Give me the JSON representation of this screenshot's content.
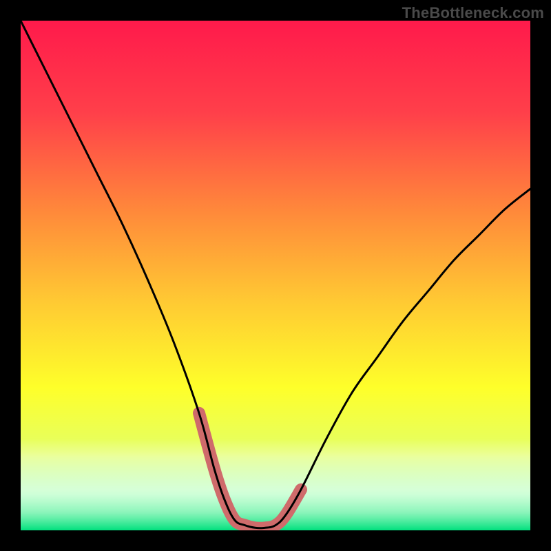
{
  "watermark": "TheBottleneck.com",
  "chart_data": {
    "type": "line",
    "title": "",
    "xlabel": "",
    "ylabel": "",
    "xlim": [
      0,
      100
    ],
    "ylim": [
      0,
      100
    ],
    "grid": false,
    "legend": false,
    "annotations": [],
    "series": [
      {
        "name": "curve",
        "color": "#000000",
        "x": [
          0,
          5,
          10,
          15,
          20,
          25,
          30,
          35,
          38,
          40,
          42,
          44,
          46,
          48,
          50,
          52,
          55,
          60,
          65,
          70,
          75,
          80,
          85,
          90,
          95,
          100
        ],
        "y": [
          100,
          90,
          80,
          70,
          60,
          49,
          37,
          23,
          12,
          6,
          2,
          1,
          0.5,
          0.5,
          1,
          3,
          8,
          18,
          27,
          34,
          41,
          47,
          53,
          58,
          63,
          67
        ]
      },
      {
        "name": "highlight",
        "color": "#cf6b6b",
        "x": [
          35,
          38,
          40,
          42,
          44,
          46,
          48,
          50,
          52,
          55
        ],
        "y": [
          23,
          12,
          6,
          2,
          1,
          0.5,
          0.5,
          1,
          3,
          8
        ]
      }
    ],
    "background_gradient": {
      "stops": [
        {
          "offset": 0.0,
          "color": "#ff1a4b"
        },
        {
          "offset": 0.18,
          "color": "#ff3f4a"
        },
        {
          "offset": 0.38,
          "color": "#ff8b3a"
        },
        {
          "offset": 0.55,
          "color": "#ffc933"
        },
        {
          "offset": 0.72,
          "color": "#feff2a"
        },
        {
          "offset": 0.85,
          "color": "#e3ff66"
        },
        {
          "offset": 0.93,
          "color": "#9bffb0"
        },
        {
          "offset": 1.0,
          "color": "#00e07e"
        }
      ],
      "bottom_band": {
        "from": 0.82,
        "to": 1.0
      }
    }
  }
}
